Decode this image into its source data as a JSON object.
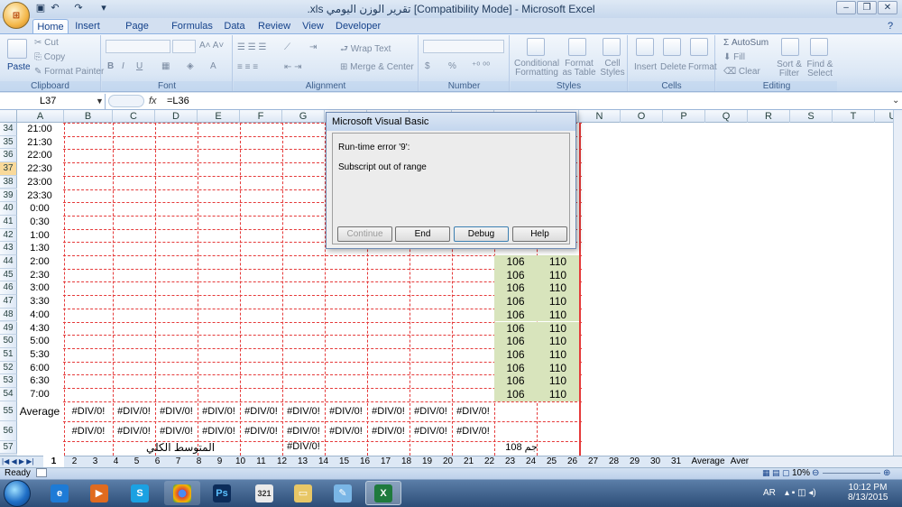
{
  "window": {
    "title": ".xls  تقرير الوزن اليومي  [Compatibility Mode] - Microsoft Excel"
  },
  "ribbon_tabs": [
    "Home",
    "Insert",
    "Page Layout",
    "Formulas",
    "Data",
    "Review",
    "View",
    "Developer"
  ],
  "ribbon": {
    "clipboard": {
      "label": "Clipboard",
      "paste": "Paste",
      "cut": "Cut",
      "copy": "Copy",
      "format_painter": "Format Painter"
    },
    "font": {
      "label": "Font"
    },
    "alignment": {
      "label": "Alignment",
      "wrap": "Wrap Text",
      "merge": "Merge & Center"
    },
    "number": {
      "label": "Number",
      "dollar": "$",
      "percent": "%"
    },
    "styles": {
      "label": "Styles",
      "conditional": "Conditional",
      "conditional2": "Formatting",
      "format_table": "Format",
      "format_table2": "as Table",
      "cell_styles": "Cell",
      "cell_styles2": "Styles"
    },
    "cells": {
      "label": "Cells",
      "insert": "Insert",
      "delete": "Delete",
      "format": "Format"
    },
    "editing": {
      "label": "Editing",
      "autosum": "AutoSum",
      "fill": "Fill",
      "clear": "Clear",
      "sort": "Sort &",
      "sort2": "Filter",
      "find": "Find &",
      "find2": "Select"
    }
  },
  "formula_bar": {
    "name_box": "L37",
    "fx": "fx",
    "formula": "=L36"
  },
  "columns": [
    "A",
    "B",
    "C",
    "D",
    "E",
    "F",
    "G",
    "H",
    "I",
    "J",
    "K",
    "L",
    "M",
    "N",
    "O",
    "P",
    "Q",
    "R",
    "S",
    "T",
    "U"
  ],
  "rows": [
    "34",
    "35",
    "36",
    "37",
    "38",
    "39",
    "40",
    "41",
    "42",
    "43",
    "44",
    "45",
    "46",
    "47",
    "48",
    "49",
    "50",
    "51",
    "52",
    "53",
    "54",
    "55",
    "56",
    "57"
  ],
  "times": [
    "21:00",
    "21:30",
    "22:00",
    "22:30",
    "23:00",
    "23:30",
    "0:00",
    "0:30",
    "1:00",
    "1:30",
    "2:00",
    "2:30",
    "3:00",
    "3:30",
    "4:00",
    "4:30",
    "5:00",
    "5:30",
    "6:00",
    "6:30",
    "7:00"
  ],
  "green_values": {
    "col1": "106",
    "col2": "110"
  },
  "average_label": "Average",
  "div_error": "#DIV/0!",
  "footer_row": {
    "arabic_label": "المتوسط الكلي",
    "value": "#DIV/0!",
    "right_text": "جم 108"
  },
  "dialog": {
    "title": "Microsoft Visual Basic",
    "error_line": "Run-time error '9':",
    "message": "Subscript out of range",
    "buttons": {
      "continue": "Continue",
      "end": "End",
      "debug": "Debug",
      "help": "Help"
    }
  },
  "sheet_tabs": [
    "1",
    "2",
    "3",
    "4",
    "5",
    "6",
    "7",
    "8",
    "9",
    "10",
    "11",
    "12",
    "13",
    "14",
    "15",
    "16",
    "17",
    "18",
    "19",
    "20",
    "21",
    "22",
    "23",
    "24",
    "25",
    "26",
    "27",
    "28",
    "29",
    "30",
    "31",
    "Average",
    "Average S"
  ],
  "status": {
    "mode": "Ready",
    "zoom": "10%"
  },
  "tray": {
    "lang": "AR",
    "time": "10:12 PM",
    "date": "8/13/2015"
  }
}
